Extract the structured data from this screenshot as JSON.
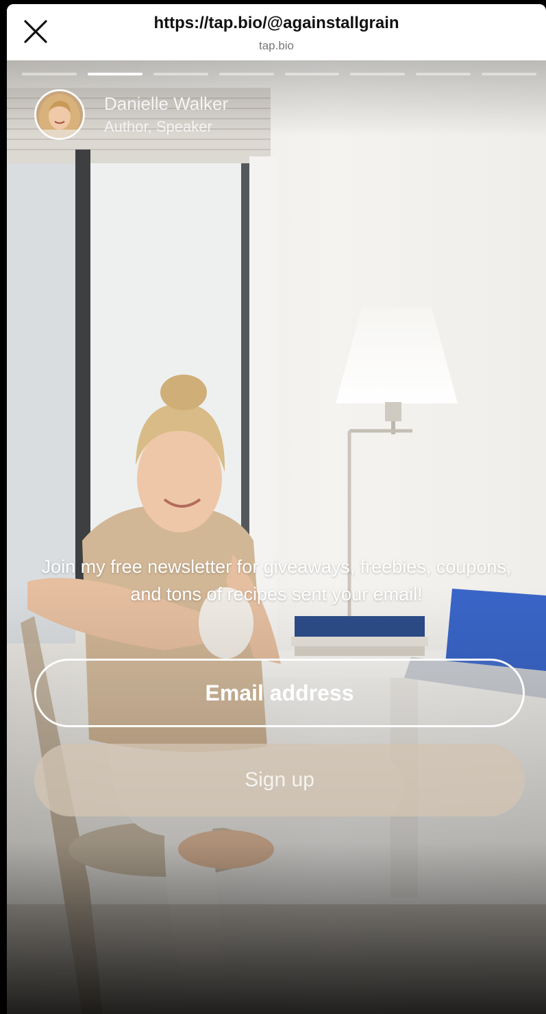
{
  "browser": {
    "url_title": "https://tap.bio/@againstallgrain",
    "domain": "tap.bio"
  },
  "story": {
    "segments": 8,
    "active_segment": 2
  },
  "profile": {
    "name": "Danielle Walker",
    "role": "Author, Speaker"
  },
  "newsletter": {
    "description": "Join my free newsletter for giveaways, freebies, coupons, and tons of recipes sent your email!",
    "email_placeholder": "Email address",
    "signup_label": "Sign up"
  },
  "icons": {
    "close": "close-icon",
    "avatar": "profile-photo"
  }
}
